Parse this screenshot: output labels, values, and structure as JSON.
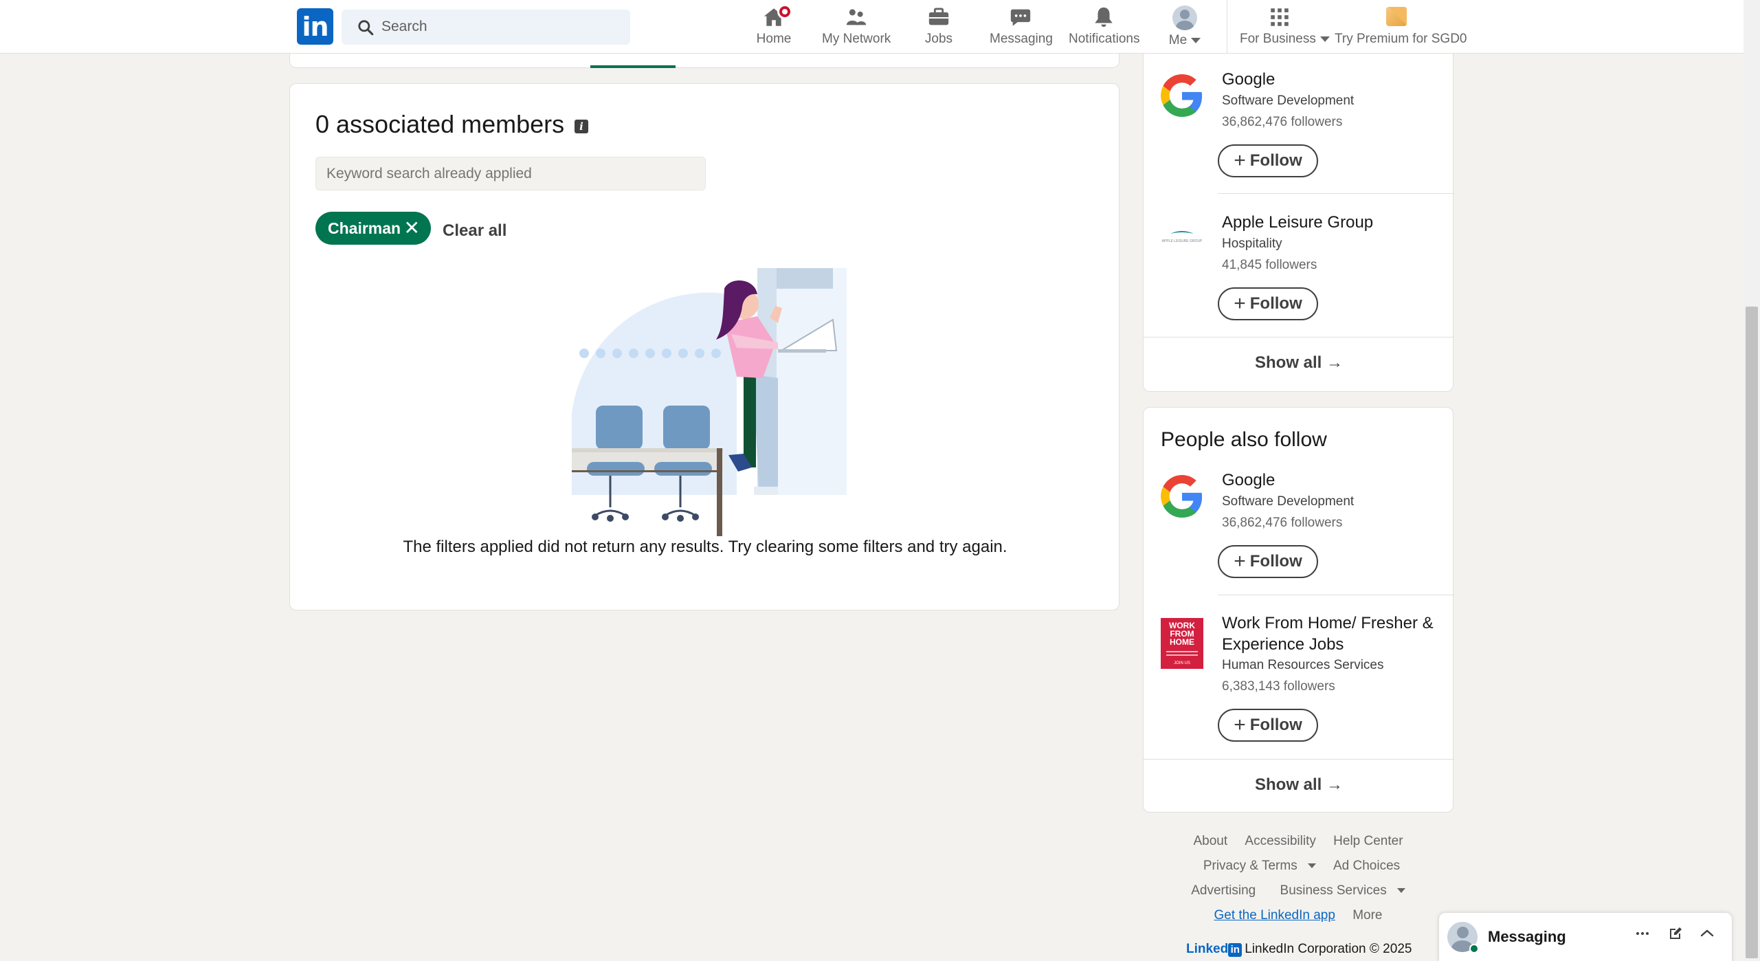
{
  "nav": {
    "search_placeholder": "Search",
    "items": [
      {
        "label": "Home",
        "icon": "home-icon"
      },
      {
        "label": "My Network",
        "icon": "network-icon"
      },
      {
        "label": "Jobs",
        "icon": "briefcase-icon"
      },
      {
        "label": "Messaging",
        "icon": "chat-icon"
      },
      {
        "label": "Notifications",
        "icon": "bell-icon"
      },
      {
        "label": "Me",
        "icon": "avatar"
      },
      {
        "label": "For Business",
        "icon": "grid-icon"
      },
      {
        "label": "Try Premium for SGD0",
        "icon": "premium-icon"
      }
    ],
    "logo_text": "in"
  },
  "main": {
    "title": "0 associated members",
    "keyword_placeholder": "Keyword search already applied",
    "chip_label": "Chairman",
    "clear_all": "Clear all",
    "empty_message": "The filters applied did not return any results. Try clearing some filters and try again."
  },
  "rail1": {
    "orgs": [
      {
        "name": "Google",
        "industry": "Software Development",
        "followers": "36,862,476 followers",
        "follow": "Follow"
      },
      {
        "name": "Apple Leisure Group",
        "industry": "Hospitality",
        "followers": "41,845 followers",
        "follow": "Follow",
        "logo_text": "APPLE LEISURE GROUP"
      }
    ],
    "show_all": "Show all →"
  },
  "rail2": {
    "heading": "People also follow",
    "orgs": [
      {
        "name": "Google",
        "industry": "Software Development",
        "followers": "36,862,476 followers",
        "follow": "Follow"
      },
      {
        "name": "Work From Home/ Fresher & Experience Jobs",
        "industry": "Human Resources Services",
        "followers": "6,383,143 followers",
        "follow": "Follow",
        "logo_text": "WORK FROM HOME",
        "logo_sub": "JOIN US"
      }
    ],
    "show_all": "Show all →"
  },
  "footer": {
    "links": [
      "About",
      "Accessibility",
      "Help Center",
      "Privacy & Terms",
      "Ad Choices",
      "Advertising",
      "Business Services",
      "Get the LinkedIn app",
      "More"
    ],
    "brand_word": "Linked",
    "brand_box": "in",
    "copyright": "LinkedIn Corporation © 2025"
  },
  "messaging": {
    "label": "Messaging"
  },
  "colors": {
    "brand": "#0a66c2",
    "accent_green": "#01754f",
    "notification_red": "#cb112d"
  }
}
